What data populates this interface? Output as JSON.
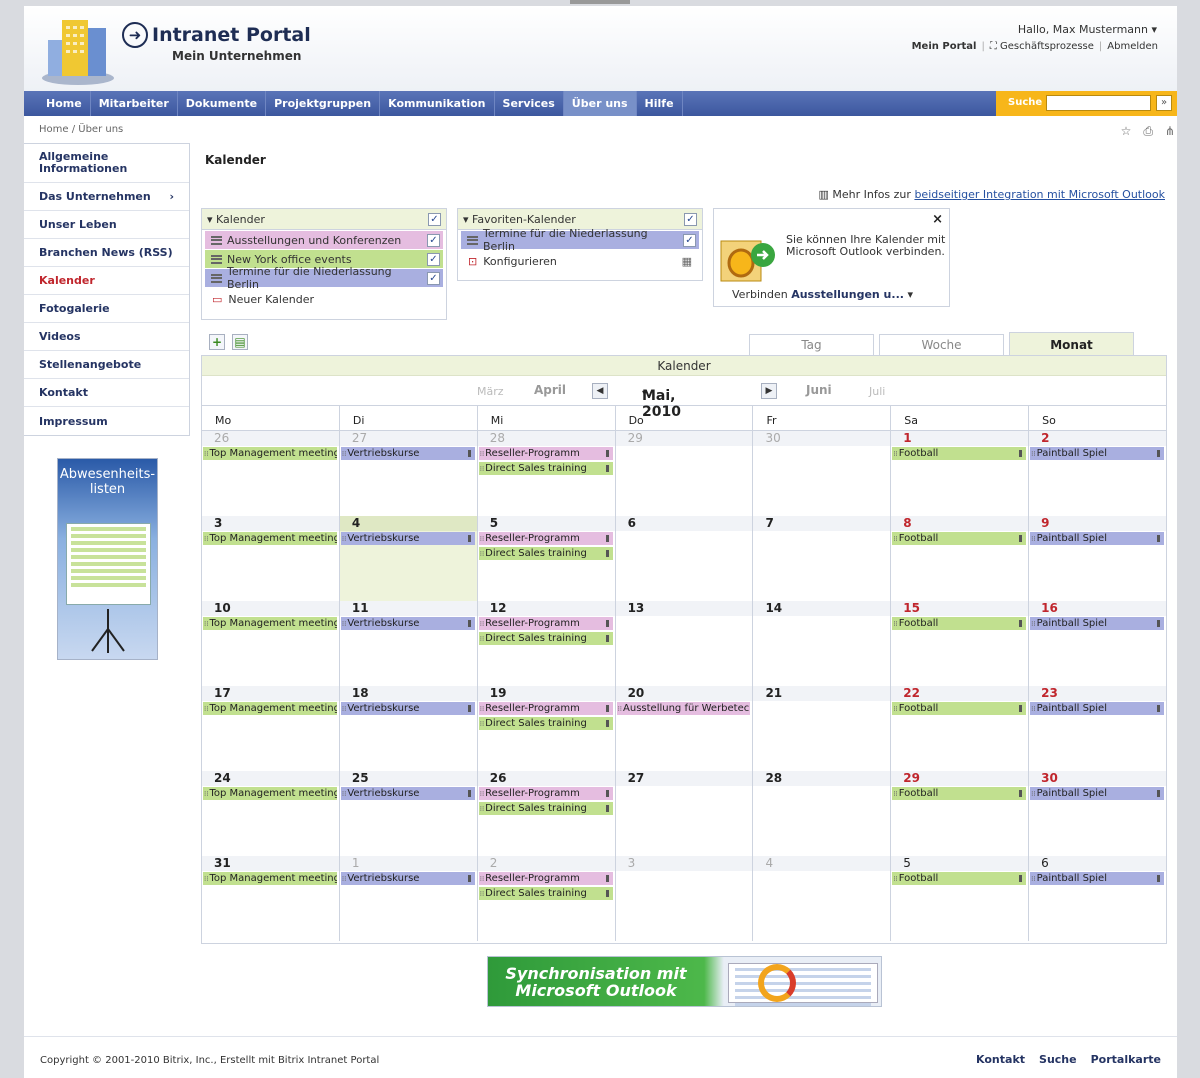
{
  "header": {
    "title": "Intranet Portal",
    "subtitle": "Mein Unternehmen",
    "greeting": "Hallo, Max Mustermann",
    "user_links": [
      "Mein Portal",
      "Geschäftsprozesse",
      "Abmelden"
    ]
  },
  "nav": {
    "items": [
      "Home",
      "Mitarbeiter",
      "Dokumente",
      "Projektgruppen",
      "Kommunikation",
      "Services",
      "Über uns",
      "Hilfe"
    ],
    "active": "Über uns",
    "search_label": "Suche",
    "search_go": "»"
  },
  "breadcrumb": "Home / Über uns",
  "sidebar": {
    "items": [
      "Allgemeine Informationen",
      "Das Unternehmen",
      "Unser Leben",
      "Branchen News (RSS)",
      "Kalender",
      "Fotogalerie",
      "Videos",
      "Stellenangebote",
      "Kontakt",
      "Impressum"
    ],
    "active": "Kalender"
  },
  "absence_widget": {
    "title": "Abwesenheits-listen"
  },
  "content": {
    "title": "Kalender",
    "outlook_info_prefix": "Mehr Infos zur",
    "outlook_info_link": "beidseitiger Integration mit Microsoft Outlook"
  },
  "calendars_panel": {
    "title": "Kalender",
    "items": [
      {
        "name": "Ausstellungen und Konferenzen",
        "color": "#e5bde0"
      },
      {
        "name": "New York office events",
        "color": "#c1e08f"
      },
      {
        "name": "Termine für die Niederlassung Berlin",
        "color": "#a9afe0"
      }
    ],
    "new_label": "Neuer Kalender"
  },
  "favorites_panel": {
    "title": "Favoriten-Kalender",
    "items": [
      {
        "name": "Termine für die Niederlassung Berlin",
        "color": "#a9afe0"
      }
    ],
    "configure_label": "Konfigurieren"
  },
  "outlook_panel": {
    "text": "Sie können Ihre Kalender mit Microsoft Outlook verbinden.",
    "connect_prefix": "Verbinden",
    "connect_target": "Ausstellungen u..."
  },
  "view_tabs": [
    "Tag",
    "Woche",
    "Monat"
  ],
  "active_view": "Monat",
  "calendar": {
    "title": "Kalender",
    "months": {
      "far_prev": "März",
      "prev": "April",
      "current": "Mai, 2010",
      "next": "Juni",
      "far_next": "Juli"
    },
    "weekdays": [
      "Mo",
      "Di",
      "Mi",
      "Do",
      "Fr",
      "Sa",
      "So"
    ],
    "weeks": [
      [
        "26",
        "27",
        "28",
        "29",
        "30",
        "1",
        "2"
      ],
      [
        "3",
        "4",
        "5",
        "6",
        "7",
        "8",
        "9"
      ],
      [
        "10",
        "11",
        "12",
        "13",
        "14",
        "15",
        "16"
      ],
      [
        "17",
        "18",
        "19",
        "20",
        "21",
        "22",
        "23"
      ],
      [
        "24",
        "25",
        "26",
        "27",
        "28",
        "29",
        "30"
      ],
      [
        "31",
        "1",
        "2",
        "3",
        "4",
        "5",
        "6"
      ]
    ],
    "events": {
      "mon": "Top Management meeting!",
      "tue": "Vertriebskurse",
      "wed1": "Reseller-Programm",
      "wed2": "Direct Sales training",
      "thu_w4": "Ausstellung für Werbetech",
      "sat": "Football",
      "sun": "Paintball Spiel"
    }
  },
  "banner": {
    "text": "Synchronisation mit Microsoft Outlook"
  },
  "footer": {
    "copyright": "Copyright © 2001-2010 Bitrix, Inc., Erstellt mit Bitrix Intranet Portal",
    "links": [
      "Kontakt",
      "Suche",
      "Portalkarte"
    ]
  }
}
